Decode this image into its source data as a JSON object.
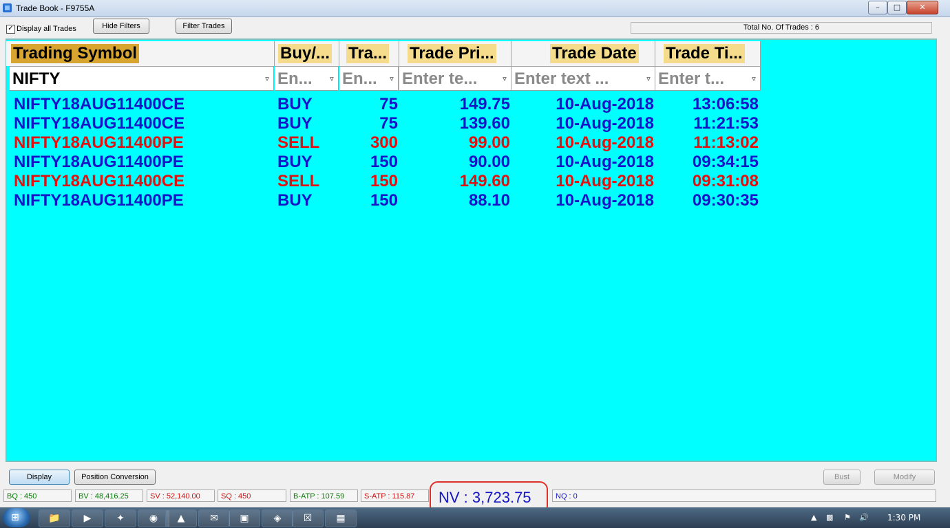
{
  "window": {
    "title": "Trade Book - F9755A",
    "minimize": "–",
    "maximize": "□",
    "close": "✕"
  },
  "toolbar": {
    "display_all_checked": "✓",
    "display_all_label": "Display all Trades",
    "hide_filters_label": "Hide Filters",
    "filter_trades_label": "Filter Trades",
    "total_trades": "Total No. Of Trades : 6"
  },
  "columns": [
    {
      "label": "Trading Symbol",
      "filter_value": "NIFTY",
      "filter_placeholder": ""
    },
    {
      "label": "Buy/...",
      "filter_value": "",
      "filter_placeholder": "En..."
    },
    {
      "label": "Tra...",
      "filter_value": "",
      "filter_placeholder": "En..."
    },
    {
      "label": "Trade Pri...",
      "filter_value": "",
      "filter_placeholder": "Enter te..."
    },
    {
      "label": "Trade Date",
      "filter_value": "",
      "filter_placeholder": "Enter text ..."
    },
    {
      "label": "Trade Ti...",
      "filter_value": "",
      "filter_placeholder": "Enter t..."
    }
  ],
  "rows": [
    {
      "symbol": "NIFTY18AUG11400CE",
      "side": "BUY",
      "qty": "75",
      "price": "149.75",
      "date": "10-Aug-2018",
      "time": "13:06:58",
      "color": "#1414c8"
    },
    {
      "symbol": "NIFTY18AUG11400CE",
      "side": "BUY",
      "qty": "75",
      "price": "139.60",
      "date": "10-Aug-2018",
      "time": "11:21:53",
      "color": "#1414c8"
    },
    {
      "symbol": "NIFTY18AUG11400PE",
      "side": "SELL",
      "qty": "300",
      "price": "99.00",
      "date": "10-Aug-2018",
      "time": "11:13:02",
      "color": "#e41010"
    },
    {
      "symbol": "NIFTY18AUG11400PE",
      "side": "BUY",
      "qty": "150",
      "price": "90.00",
      "date": "10-Aug-2018",
      "time": "09:34:15",
      "color": "#1414c8"
    },
    {
      "symbol": "NIFTY18AUG11400CE",
      "side": "SELL",
      "qty": "150",
      "price": "149.60",
      "date": "10-Aug-2018",
      "time": "09:31:08",
      "color": "#e41010"
    },
    {
      "symbol": "NIFTY18AUG11400PE",
      "side": "BUY",
      "qty": "150",
      "price": "88.10",
      "date": "10-Aug-2018",
      "time": "09:30:35",
      "color": "#1414c8"
    }
  ],
  "bottom": {
    "display_label": "Display",
    "position_conversion_label": "Position Conversion",
    "bust_label": "Bust",
    "modify_label": "Modify"
  },
  "status": {
    "bq": "BQ : 450",
    "bv": "BV : 48,416.25",
    "sv": "SV : 52,140.00",
    "sq": "SQ : 450",
    "batp": "B-ATP : 107.59",
    "satp": "S-ATP : 115.87",
    "nv": "NV : 3,723.75",
    "nq": "NQ : 0"
  },
  "taskbar": {
    "start_glyph": "⊞",
    "items": [
      "📁",
      "▶",
      "✦",
      "◉",
      "▲",
      "✉",
      "▣",
      "◈",
      "☒",
      "▦"
    ],
    "clock": "1:30 PM"
  },
  "colors": {
    "buy": "#1414c8",
    "sell": "#e41010",
    "grid_bg": "#00ffff",
    "header_highlight": "#f5dc8c",
    "symbol_header_highlight": "#d9a531"
  }
}
